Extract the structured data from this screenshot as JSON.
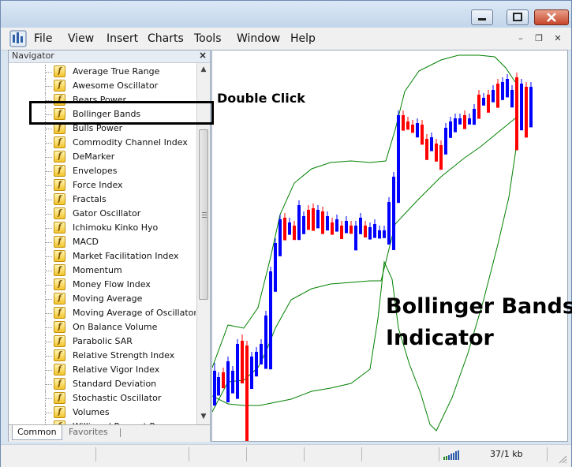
{
  "menu": [
    "File",
    "View",
    "Insert",
    "Charts",
    "Tools",
    "Window",
    "Help"
  ],
  "navigator": {
    "title": "Navigator",
    "items": [
      "Average True Range",
      "Awesome Oscillator",
      "Bears Power",
      "Bollinger Bands",
      "Bulls Power",
      "Commodity Channel Index",
      "DeMarker",
      "Envelopes",
      "Force Index",
      "Fractals",
      "Gator Oscillator",
      "Ichimoku Kinko Hyo",
      "MACD",
      "Market Facilitation Index",
      "Momentum",
      "Money Flow Index",
      "Moving Average",
      "Moving Average of Oscillator",
      "On Balance Volume",
      "Parabolic SAR",
      "Relative Strength Index",
      "Relative Vigor Index",
      "Standard Deviation",
      "Stochastic Oscillator",
      "Volumes",
      "Williams' Percent Range"
    ],
    "highlighted": "Bollinger Bands",
    "tabs": [
      "Common",
      "Favorites"
    ],
    "active_tab": "Common"
  },
  "annotation": {
    "callout": "Double Click",
    "big_line1": "Bollinger Bands",
    "big_line2": "Indicator"
  },
  "status": {
    "traffic": "37/1 kb"
  },
  "colors": {
    "bull": "#0000ff",
    "bear": "#ff0000",
    "band": "#008000"
  },
  "icons": {
    "app": "metatrader-app-icon",
    "indicator": "custom-indicator-f-icon",
    "window_controls": [
      "minimize-icon",
      "maximize-icon",
      "close-icon"
    ]
  }
}
